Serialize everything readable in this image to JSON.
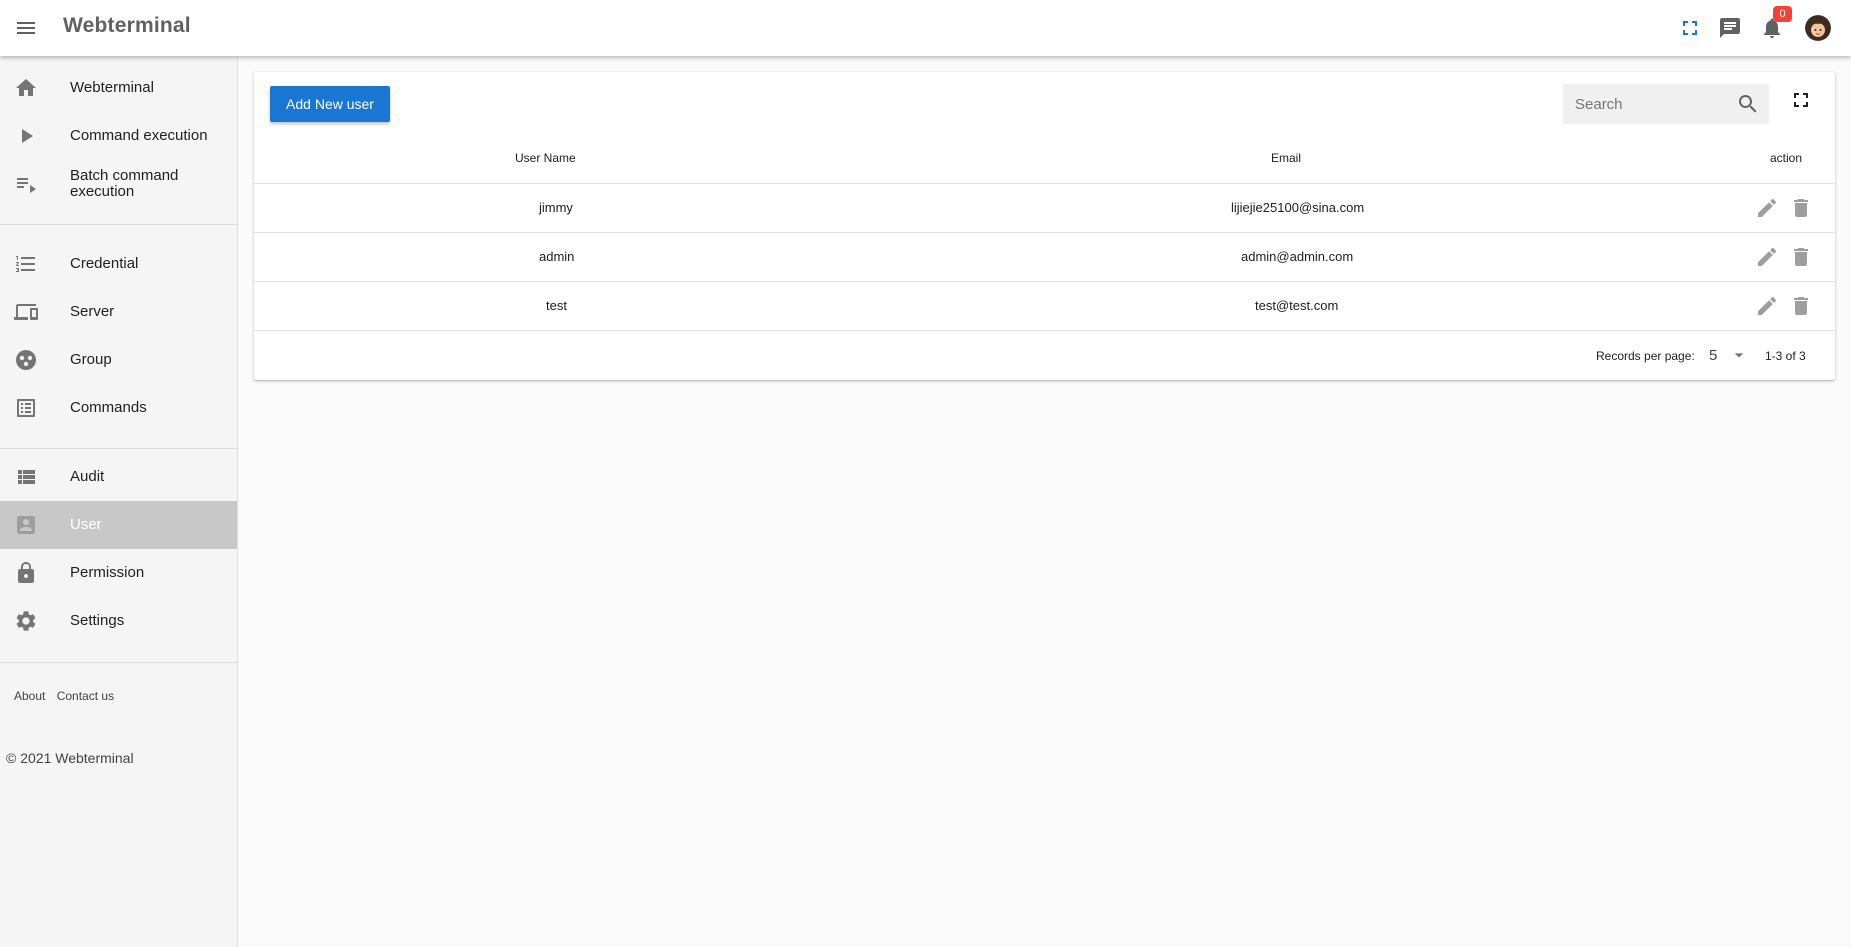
{
  "header": {
    "title": "Webterminal",
    "notification_count": "0"
  },
  "sidebar": {
    "groups": [
      [
        {
          "label": "Webterminal",
          "icon": "home-icon"
        },
        {
          "label": "Command execution",
          "icon": "play-icon"
        },
        {
          "label": "Batch command execution",
          "icon": "playlist-icon"
        }
      ],
      [
        {
          "label": "Credential",
          "icon": "list-numbered-icon"
        },
        {
          "label": "Server",
          "icon": "devices-icon"
        },
        {
          "label": "Group",
          "icon": "group-icon"
        },
        {
          "label": "Commands",
          "icon": "list-alt-icon"
        }
      ],
      [
        {
          "label": "Audit",
          "icon": "view-list-icon"
        },
        {
          "label": "User",
          "icon": "account-box-icon",
          "active": true
        },
        {
          "label": "Permission",
          "icon": "lock-icon"
        },
        {
          "label": "Settings",
          "icon": "gear-icon"
        }
      ]
    ],
    "footer_links": [
      "About",
      "Contact us"
    ],
    "copyright": "© 2021 Webterminal"
  },
  "toolbar": {
    "add_label": "Add New user",
    "search_placeholder": "Search"
  },
  "table": {
    "columns": [
      "User Name",
      "Email",
      "action"
    ],
    "rows": [
      {
        "username": "jimmy",
        "email": "lijiejie25100@sina.com"
      },
      {
        "username": "admin",
        "email": "admin@admin.com"
      },
      {
        "username": "test",
        "email": "test@test.com"
      }
    ]
  },
  "pagination": {
    "records_label": "Records per page:",
    "per_page": "5",
    "range": "1-3 of 3"
  },
  "colors": {
    "accent": "#1976d2",
    "badge": "#f44336",
    "active_nav": "#c8c8c8"
  }
}
